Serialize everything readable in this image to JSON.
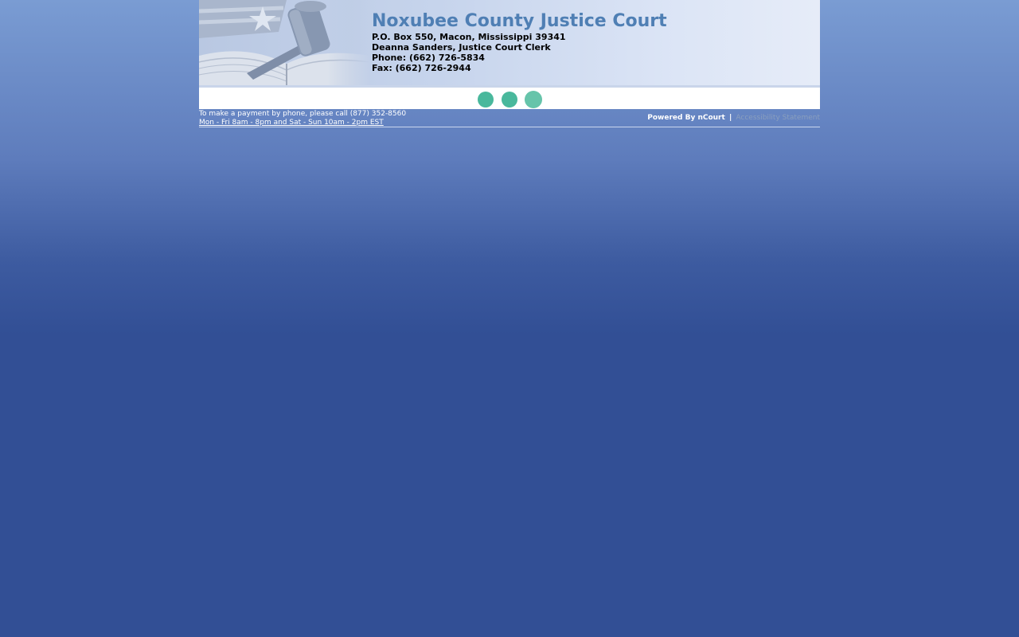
{
  "header": {
    "title": "Noxubee County Justice Court",
    "address": "P.O. Box 550, Macon, Mississippi 39341",
    "clerk": "Deanna Sanders, Justice Court Clerk",
    "phone": "Phone: (662) 726-5834",
    "fax": "Fax: (662) 726-2944",
    "art_icons": [
      "flag-icon",
      "gavel-icon",
      "open-book-icon"
    ]
  },
  "nav": {
    "dots": [
      "nav-dot-1",
      "nav-dot-2",
      "nav-dot-3"
    ],
    "colors": {
      "dot": "#49b89c",
      "dot_active": "#66c4aa"
    }
  },
  "info_bar": {
    "payment_line": "To make a payment by phone, please call (877) 352-8560",
    "hours_line": "Mon - Fri 8am - 8pm and Sat - Sun 10am - 2pm EST",
    "powered_by": "Powered By nCourt",
    "separator": "|",
    "accessibility_link": "Accessibility Statement"
  },
  "colors": {
    "title": "#4f7fb4",
    "background_top": "#7a9cd3",
    "background_bottom": "#324f95"
  }
}
